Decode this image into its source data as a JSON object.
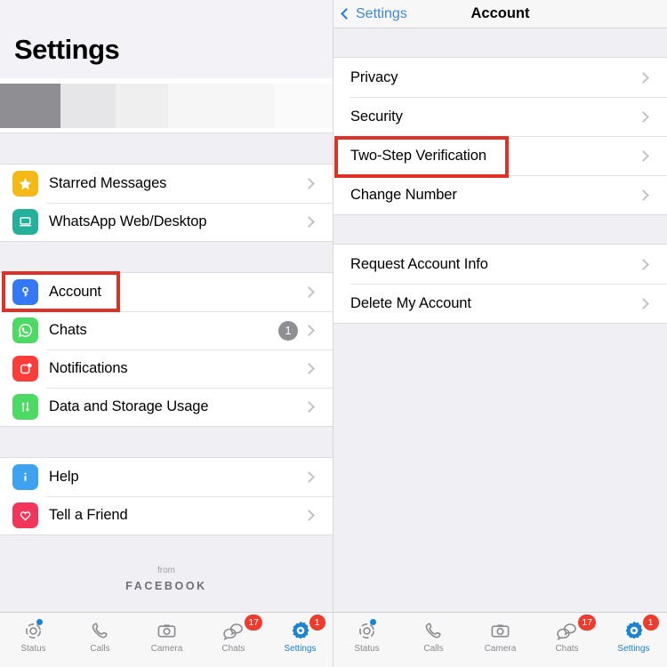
{
  "app": {
    "name": "WhatsApp",
    "platform": "iOS"
  },
  "left_panel": {
    "title": "Settings",
    "profile_row": {
      "redacted": true
    },
    "groups": [
      {
        "rows": [
          {
            "label": "Starred Messages",
            "icon": "star-icon",
            "icon_color": "#F5B916",
            "badge": ""
          },
          {
            "label": "WhatsApp Web/Desktop",
            "icon": "laptop-icon",
            "icon_color": "#25B09B",
            "badge": ""
          }
        ]
      },
      {
        "rows": [
          {
            "label": "Account",
            "icon": "key-icon",
            "icon_color": "#3478F6",
            "badge": ""
          },
          {
            "label": "Chats",
            "icon": "whatsapp-icon",
            "icon_color": "#4CD964",
            "badge": "1"
          },
          {
            "label": "Notifications",
            "icon": "notification-icon",
            "icon_color": "#FC3D39",
            "badge": ""
          },
          {
            "label": "Data and Storage Usage",
            "icon": "data-usage-icon",
            "icon_color": "#4CD964",
            "badge": ""
          }
        ]
      },
      {
        "rows": [
          {
            "label": "Help",
            "icon": "info-icon",
            "icon_color": "#3EA2F0",
            "badge": ""
          },
          {
            "label": "Tell a Friend",
            "icon": "heart-icon",
            "icon_color": "#F2355B",
            "badge": ""
          }
        ]
      }
    ],
    "footer": {
      "from": "from",
      "brand": "FACEBOOK"
    }
  },
  "right_panel": {
    "nav": {
      "back_label": "Settings",
      "title": "Account"
    },
    "groups": [
      {
        "rows": [
          {
            "label": "Privacy"
          },
          {
            "label": "Security"
          },
          {
            "label": "Two-Step Verification"
          },
          {
            "label": "Change Number"
          }
        ]
      },
      {
        "rows": [
          {
            "label": "Request Account Info"
          },
          {
            "label": "Delete My Account"
          }
        ]
      }
    ]
  },
  "highlights": [
    {
      "target": "Account",
      "color": "#e03127"
    },
    {
      "target": "Two-Step Verification",
      "color": "#e03127"
    }
  ],
  "tabbar": {
    "active": "Settings",
    "tabs": [
      {
        "label": "Status",
        "icon": "status-icon",
        "badge": "",
        "dot": true
      },
      {
        "label": "Calls",
        "icon": "phone-icon",
        "badge": "",
        "dot": false
      },
      {
        "label": "Camera",
        "icon": "camera-icon",
        "badge": "",
        "dot": false
      },
      {
        "label": "Chats",
        "icon": "chat-bubbles-icon",
        "badge": "17",
        "dot": false
      },
      {
        "label": "Settings",
        "icon": "gear-icon",
        "badge": "1",
        "dot": false
      }
    ]
  }
}
